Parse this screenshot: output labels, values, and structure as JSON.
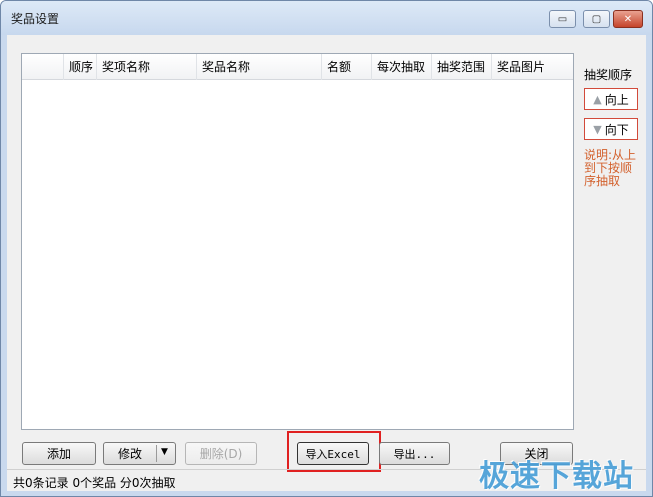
{
  "window": {
    "title": "奖品设置",
    "controls": {
      "minimize": "▭",
      "maximize": "▢",
      "close": "✕"
    }
  },
  "table": {
    "columns": [
      "",
      "顺序",
      "奖项名称",
      "奖品名称",
      "名额",
      "每次抽取",
      "抽奖范围",
      "奖品图片"
    ],
    "rows": []
  },
  "side_panel": {
    "title": "抽奖顺序",
    "up_label": "向上",
    "down_label": "向下",
    "up_icon": "arrow-up-icon",
    "down_icon": "arrow-down-icon",
    "note": "说明:从上到下按顺序抽取"
  },
  "buttons": {
    "add": "添加",
    "edit": "修改",
    "delete": "删除(D)",
    "import": "导入Excel",
    "export": "导出...",
    "close": "关闭"
  },
  "status": "共0条记录 0个奖品 分0次抽取",
  "watermark": "极速下载站",
  "colors": {
    "highlight": "#e02020",
    "note": "#d3612d",
    "watermark": "#4a9fd8",
    "side_button_border": "#d24a3a"
  }
}
